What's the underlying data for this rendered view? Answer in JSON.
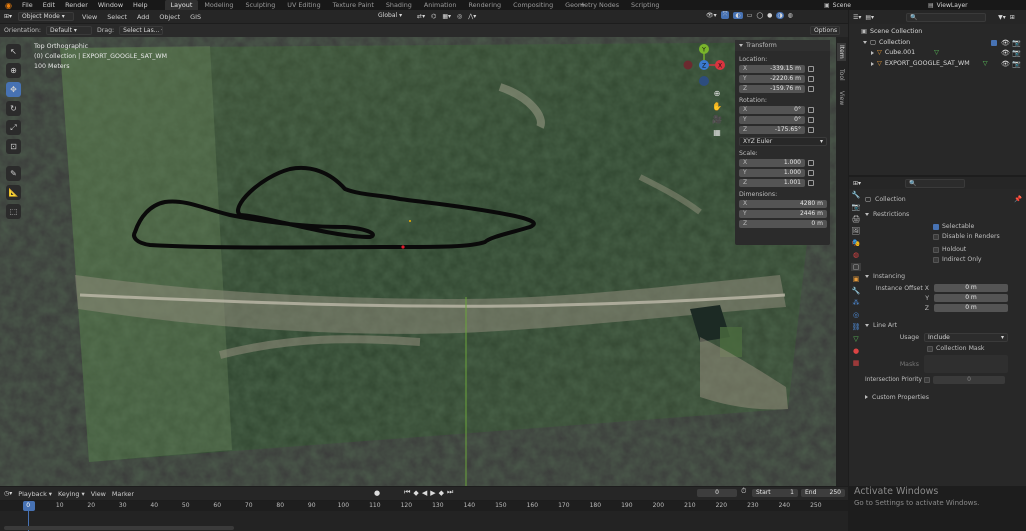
{
  "menu": {
    "items": [
      "File",
      "Edit",
      "Render",
      "Window",
      "Help"
    ]
  },
  "workspaces": [
    "Layout",
    "Modeling",
    "Sculpting",
    "UV Editing",
    "Texture Paint",
    "Shading",
    "Animation",
    "Rendering",
    "Compositing",
    "Geometry Nodes",
    "Scripting"
  ],
  "scene": {
    "label": "Scene",
    "view_layer": "ViewLayer"
  },
  "viewport": {
    "mode": "Object Mode",
    "header_menus": [
      "View",
      "Select",
      "Add",
      "Object",
      "GIS"
    ],
    "transform_orientation": "Global",
    "orientation_label": "Orientation:",
    "orientation_value": "Default",
    "drag_label": "Drag:",
    "drag_value": "Select Las...",
    "options": "Options",
    "overlay_lines": [
      "Top Orthographic",
      "(0) Collection | EXPORT_GOOGLE_SAT_WM",
      "100 Meters"
    ]
  },
  "gizmo": {
    "x": "X",
    "y": "Y",
    "z": "Z"
  },
  "npanel": {
    "title": "Transform",
    "location_label": "Location:",
    "location": [
      {
        "axis": "X",
        "value": "-339.15 m"
      },
      {
        "axis": "Y",
        "value": "-2220.6 m"
      },
      {
        "axis": "Z",
        "value": "-159.76 m"
      }
    ],
    "rotation_label": "Rotation:",
    "rotation": [
      {
        "axis": "X",
        "value": "0°"
      },
      {
        "axis": "Y",
        "value": "0°"
      },
      {
        "axis": "Z",
        "value": "-175.65°"
      }
    ],
    "rotation_mode": "XYZ Euler",
    "scale_label": "Scale:",
    "scale": [
      {
        "axis": "X",
        "value": "1.000"
      },
      {
        "axis": "Y",
        "value": "1.000"
      },
      {
        "axis": "Z",
        "value": "1.001"
      }
    ],
    "dimensions_label": "Dimensions:",
    "dimensions": [
      {
        "axis": "X",
        "value": "4280 m"
      },
      {
        "axis": "Y",
        "value": "2446 m"
      },
      {
        "axis": "Z",
        "value": "0 m"
      }
    ],
    "tabs": [
      "Item",
      "Tool",
      "View"
    ]
  },
  "outliner": {
    "items": [
      {
        "label": "Scene Collection"
      },
      {
        "label": "Collection"
      },
      {
        "label": "Cube.001"
      },
      {
        "label": "EXPORT_GOOGLE_SAT_WM"
      }
    ]
  },
  "properties": {
    "breadcrumb": "Collection",
    "restrictions": {
      "title": "Restrictions",
      "selectable": "Selectable",
      "disable_renders": "Disable in Renders",
      "holdout": "Holdout",
      "indirect_only": "Indirect Only"
    },
    "instancing": {
      "title": "Instancing",
      "offset_label": "Instance Offset X",
      "y_label": "Y",
      "z_label": "Z",
      "x": "0 m",
      "y": "0 m",
      "z": "0 m"
    },
    "line_art": {
      "title": "Line Art",
      "usage_label": "Usage",
      "usage_value": "Include",
      "collection_mask": "Collection Mask",
      "masks_label": "Masks",
      "intersection_priority": "Intersection Priority",
      "priority_value": "0"
    },
    "custom_props": "Custom Properties"
  },
  "timeline": {
    "menus": [
      "Playback",
      "Keying",
      "View",
      "Marker"
    ],
    "current_frame": "0",
    "start_label": "Start",
    "start": "1",
    "end_label": "End",
    "end": "250",
    "ticks": [
      "0",
      "10",
      "20",
      "30",
      "40",
      "50",
      "60",
      "70",
      "80",
      "90",
      "100",
      "110",
      "120",
      "130",
      "140",
      "150",
      "160",
      "170",
      "180",
      "190",
      "200",
      "210",
      "220",
      "230",
      "240",
      "250"
    ]
  },
  "activation": {
    "title": "Activate Windows",
    "subtitle": "Go to Settings to activate Windows."
  },
  "colors": {
    "accent": "#4772b3",
    "track": "#0a0a0a",
    "bg": "#1d1d1d"
  }
}
